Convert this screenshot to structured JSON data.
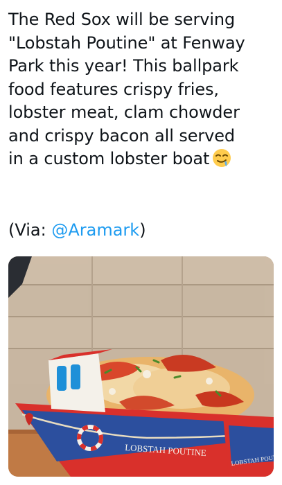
{
  "tweet": {
    "text_lines": [
      "The Red Sox will be serving",
      "\"Lobstah Poutine\" at Fenway",
      "Park this year! This ballpark",
      "food features crispy fries,",
      "lobster meat, clam chowder",
      "and crispy bacon all served",
      "in a custom lobster boat"
    ],
    "emoji": "drooling-face-emoji",
    "via_prefix": "(Via: ",
    "via_handle": "@Aramark",
    "via_suffix": ")",
    "colors": {
      "text": "#0f1419",
      "link": "#1d9bf0"
    }
  },
  "media": {
    "boat_label": "LOBSTAH POUTINE",
    "boat_label_side": "LOBSTAH POUTINE",
    "colors": {
      "boat_red": "#d9302b",
      "boat_blue": "#2c4f9e",
      "cabin_white": "#f4f1ea",
      "window_blue": "#1e90d8"
    }
  }
}
